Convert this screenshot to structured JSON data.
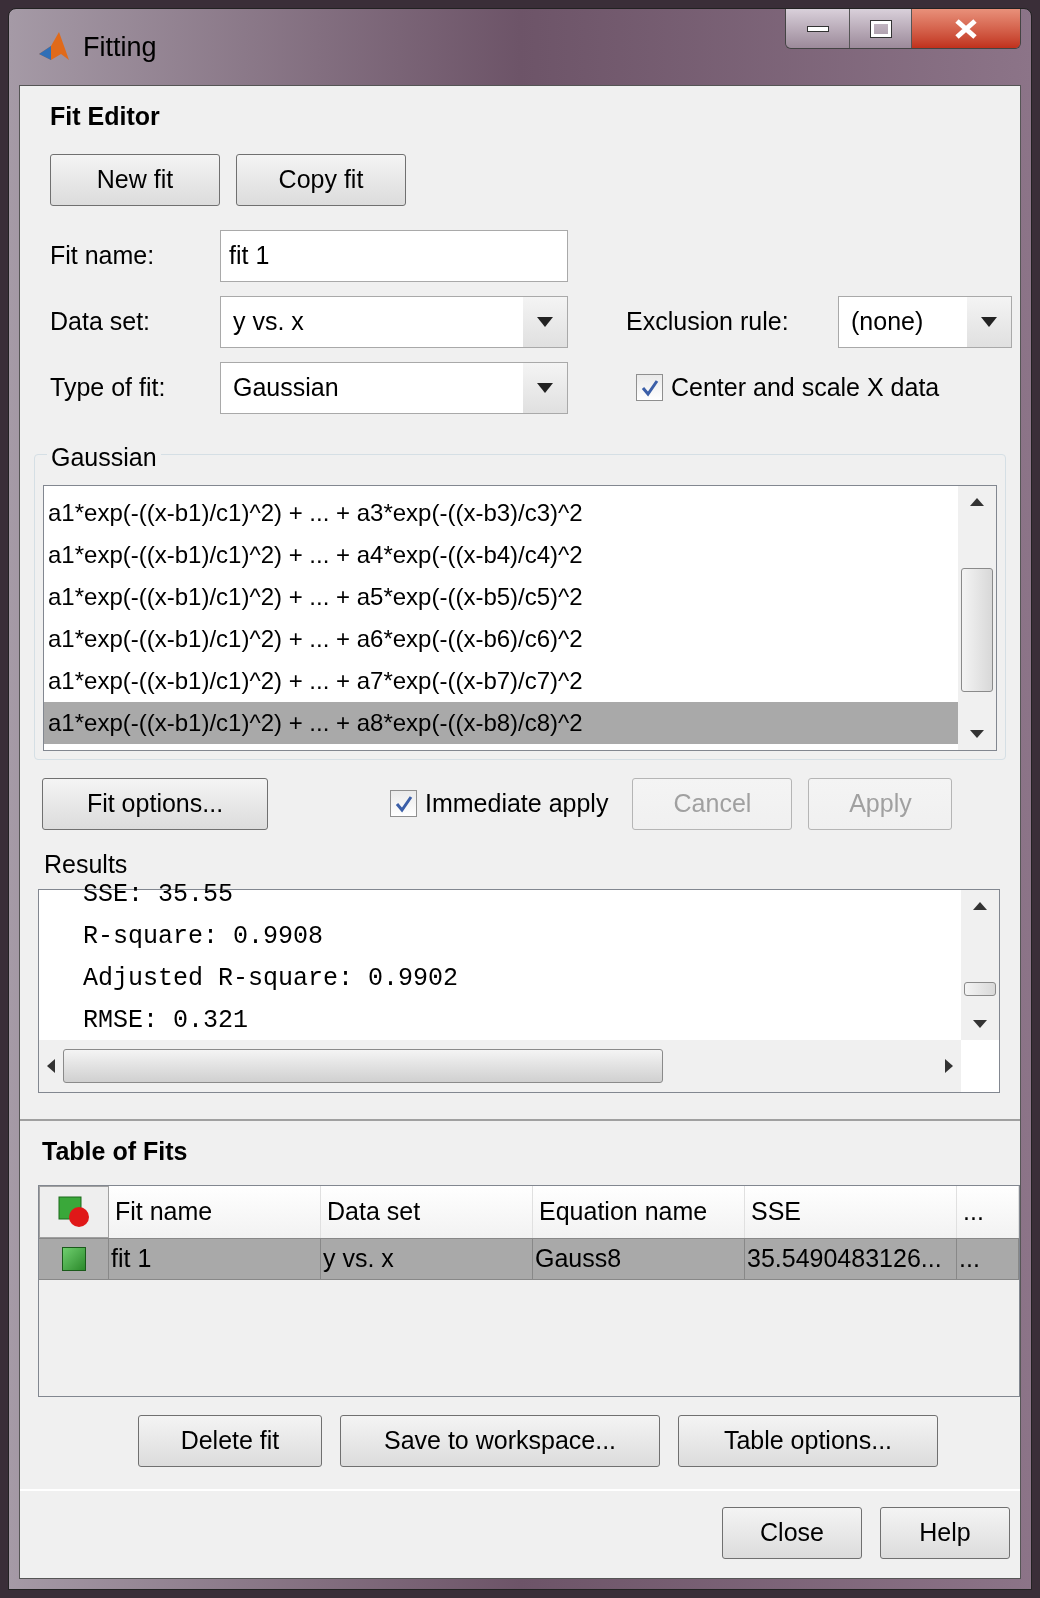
{
  "window": {
    "title": "Fitting"
  },
  "fit_editor": {
    "title": "Fit Editor",
    "buttons": [
      "New fit",
      "Copy fit"
    ],
    "fit_name": {
      "label": "Fit name:",
      "value": "fit 1"
    },
    "data_set": {
      "label": "Data set:",
      "value": "y vs. x"
    },
    "exclusion_rule": {
      "label": "Exclusion rule:",
      "value": "(none)"
    },
    "type_of_fit": {
      "label": "Type of fit:",
      "value": "Gaussian"
    },
    "center_and_scale": {
      "label": "Center and scale X data",
      "checked": true
    },
    "equations": {
      "title": "Gaussian",
      "items": [
        {
          "text": "a1*exp(-((x-b1)/c1)^2) + ... + a3*exp(-((x-b3)/c3)^2",
          "selected": false
        },
        {
          "text": "a1*exp(-((x-b1)/c1)^2) + ... + a4*exp(-((x-b4)/c4)^2",
          "selected": false
        },
        {
          "text": "a1*exp(-((x-b1)/c1)^2) + ... + a5*exp(-((x-b5)/c5)^2",
          "selected": false
        },
        {
          "text": "a1*exp(-((x-b1)/c1)^2) + ... + a6*exp(-((x-b6)/c6)^2",
          "selected": false
        },
        {
          "text": "a1*exp(-((x-b1)/c1)^2) + ... + a7*exp(-((x-b7)/c7)^2",
          "selected": false
        },
        {
          "text": "a1*exp(-((x-b1)/c1)^2) + ... + a8*exp(-((x-b8)/c8)^2",
          "selected": true
        }
      ]
    },
    "fit_options": "Fit options...",
    "immediate_apply": {
      "label": "Immediate apply",
      "checked": true
    },
    "cancel": {
      "label": "Cancel",
      "disabled": true
    },
    "apply": {
      "label": "Apply",
      "disabled": true
    },
    "results": {
      "title": "Results",
      "lines": [
        "SSE: 35.55",
        "R-square: 0.9908",
        "Adjusted R-square: 0.9902",
        "RMSE: 0.321"
      ]
    }
  },
  "table_of_fits": {
    "title": "Table of Fits",
    "columns": [
      "Fit name",
      "Data set",
      "Equation name",
      "SSE",
      "..."
    ],
    "rows": [
      {
        "cells": [
          "fit 1",
          "y vs. x",
          "Gauss8",
          "35.5490483126...",
          "..."
        ],
        "selected": true
      }
    ],
    "buttons": [
      "Delete fit",
      "Save to workspace...",
      "Table options..."
    ]
  },
  "footer_buttons": [
    "Close",
    "Help"
  ]
}
